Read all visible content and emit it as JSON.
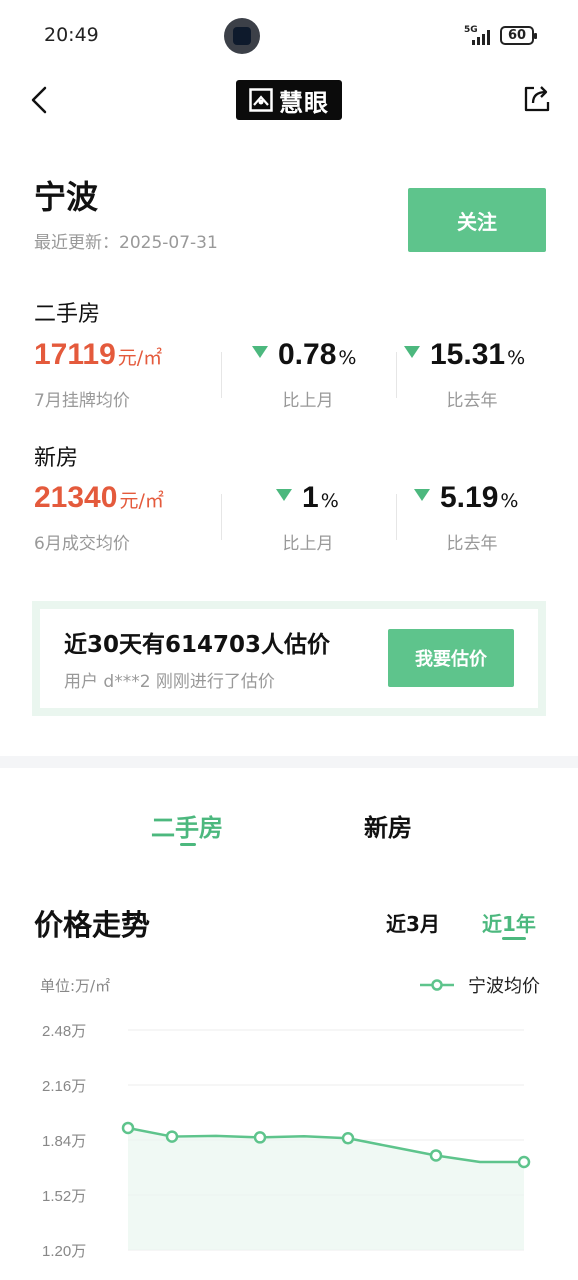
{
  "status_bar": {
    "time": "20:49",
    "network": "5G",
    "battery": "60"
  },
  "nav": {
    "logo_text": "慧眼"
  },
  "city": {
    "name": "宁波",
    "update_label": "最近更新：",
    "update_date": "2025-07-31",
    "follow_label": "关注"
  },
  "second_hand": {
    "label": "二手房",
    "price": "17119",
    "unit": "元/㎡",
    "caption": "7月挂牌均价",
    "mom": {
      "value": "0.78",
      "unit": "%",
      "caption": "比上月",
      "direction": "down"
    },
    "yoy": {
      "value": "15.31",
      "unit": "%",
      "caption": "比去年",
      "direction": "down"
    }
  },
  "new_house": {
    "label": "新房",
    "price": "21340",
    "unit": "元/㎡",
    "caption": "6月成交均价",
    "mom": {
      "value": "1",
      "unit": "%",
      "caption": "比上月",
      "direction": "down"
    },
    "yoy": {
      "value": "5.19",
      "unit": "%",
      "caption": "比去年",
      "direction": "down"
    }
  },
  "estimate": {
    "title": "近30天有614703人估价",
    "subtitle": "用户 d***2 刚刚进行了估价",
    "button": "我要估价"
  },
  "trend": {
    "tabs": [
      "二手房",
      "新房"
    ],
    "active_tab": "二手房",
    "title": "价格走势",
    "ranges": [
      "近3月",
      "近1年"
    ],
    "active_range": "近1年",
    "unit_label": "单位:万/㎡",
    "legend": "宁波均价"
  },
  "colors": {
    "accent": "#5ec48c",
    "price_red": "#e45a3c",
    "down_green": "#4cb87e"
  },
  "chart_data": {
    "type": "line",
    "series": [
      {
        "name": "宁波均价",
        "values": [
          1.91,
          1.86,
          1.864,
          1.855,
          1.862,
          1.85,
          1.8,
          1.75,
          1.712,
          1.712
        ]
      }
    ],
    "point_markers": [
      0,
      1,
      3,
      5,
      7,
      9
    ],
    "y_ticks": [
      "2.48万",
      "2.16万",
      "1.84万",
      "1.52万",
      "1.20万"
    ],
    "ylim": [
      1.2,
      2.48
    ],
    "grid": true,
    "legend_position": "top-right",
    "unit": "万/㎡"
  }
}
